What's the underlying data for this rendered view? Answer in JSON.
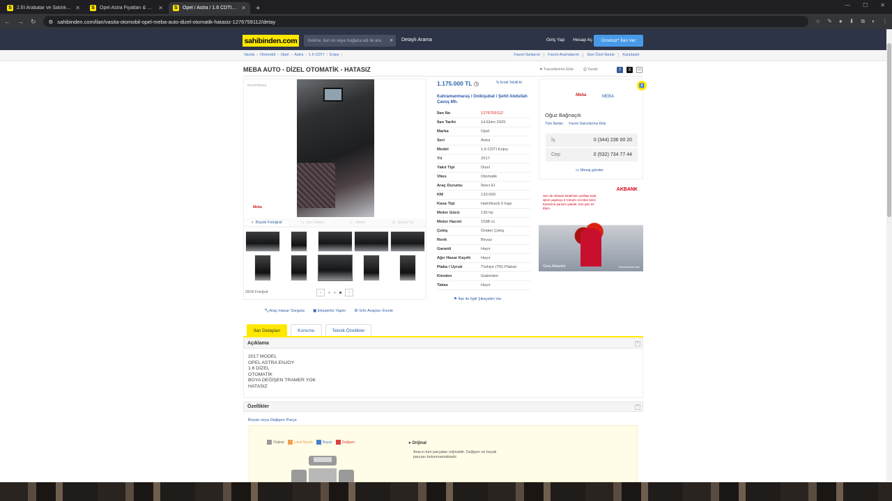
{
  "browser": {
    "tabs": [
      {
        "title": "2.El Arabalar ve Satılık Sıfır Kır...",
        "active": false
      },
      {
        "title": "Opel Astra Fiyatları & Modelle...",
        "active": false
      },
      {
        "title": "Opel / Astra / 1.6 CDTI / Enjoy",
        "active": true
      }
    ],
    "url": "sahibinden.com/ilan/vasita-otomobil-opel-meba-auto-dizel-otomatik-hatasiz-1276759112/detay"
  },
  "header": {
    "logo": "sahibinden.com",
    "search_placeholder": "Kelime, ilan no veya mağaza adı ile ara",
    "detailed_search": "Detaylı Arama",
    "login": "Giriş Yap",
    "register": "Hesap Aç",
    "post_ad": "Ücretsiz* İlan Ver"
  },
  "breadcrumb": [
    "Vasıta",
    "Otomobil",
    "Opel",
    "Astra",
    "1.6 CDTI",
    "Enjoy"
  ],
  "sub_links": [
    "Favori İlanlarım",
    "Favori Aramalarım",
    "Size Özel İlanlar",
    "Karşılaştır"
  ],
  "listing": {
    "title": "MEBA AUTO - DİZEL OTOMATİK - HATASIZ",
    "fav_label": "Favorilerime Ekle",
    "print_label": "Yazdır",
    "ad_number_small": "#1276759112",
    "photo_watermark": "Meba",
    "gallery_tabs": [
      "Büyük Fotoğraf",
      "Ses Video",
      "Video",
      "Sanal Tur"
    ],
    "photo_count": "28/30 Fotoğraf",
    "price": "1.175.000 TL",
    "credit_label": "Kredi Teklifi Al",
    "location": "Kahramanmaraş / Onikişubat / Şehit Abdullah Çavuş Mh.",
    "attributes": [
      {
        "k": "İlan No",
        "v": "1276759112"
      },
      {
        "k": "İlan Tarihi",
        "v": "14 Ekim 2025"
      },
      {
        "k": "Marka",
        "v": "Opel"
      },
      {
        "k": "Seri",
        "v": "Astra"
      },
      {
        "k": "Model",
        "v": "1.6 CDTI Enjoy"
      },
      {
        "k": "Yıl",
        "v": "2017"
      },
      {
        "k": "Yakıt Tipi",
        "v": "Dizel"
      },
      {
        "k": "Vites",
        "v": "Otomatik"
      },
      {
        "k": "Araç Durumu",
        "v": "İkinci El"
      },
      {
        "k": "KM",
        "v": "133.000"
      },
      {
        "k": "Kasa Tipi",
        "v": "Hatchback 5 kapı"
      },
      {
        "k": "Motor Gücü",
        "v": "136 hp"
      },
      {
        "k": "Motor Hacmi",
        "v": "1598 cc"
      },
      {
        "k": "Çekiş",
        "v": "Önden Çekiş"
      },
      {
        "k": "Renk",
        "v": "Beyaz"
      },
      {
        "k": "Garanti",
        "v": "Hayır"
      },
      {
        "k": "Ağır Hasar Kayıtlı",
        "v": "Hayır"
      },
      {
        "k": "Plaka / Uyruk",
        "v": "Türkiye (TR) Plakalı"
      },
      {
        "k": "Kimden",
        "v": "Galeriden"
      },
      {
        "k": "Takas",
        "v": "Hayır"
      }
    ],
    "complaint": "İlan ile İlgili Şikayetim Var",
    "actions": [
      "Araç Hasar Sorgula",
      "Ekspertiz Yaptır",
      "Sıfır Araçları İncele"
    ]
  },
  "seller": {
    "logo_text": "Meba",
    "store": "MEBA",
    "name": "Oğuz Bağrıaçık",
    "links": [
      "Tüm İlanları",
      "Favori Satıcılarıma Ekle"
    ],
    "phones": [
      {
        "label": "İş",
        "number": "0 (344) 236 00 20"
      },
      {
        "label": "Cep",
        "number": "0 (532) 734 77 44"
      }
    ],
    "message": "Mesaj gönder"
  },
  "ad": {
    "brand": "AKBANK",
    "text": "Sen de Akbank Mobil'den çekilişe katıl, işlem yaptıkça 3 Citroën Ami'den birini kazanma şansını yakala. Son gün 31 Ekim",
    "footer": "Genç Akbanklı",
    "footer2": "Güvenmenle sen"
  },
  "tabs": [
    "İlan Detayları",
    "Konumu",
    "Teknik Özellikler"
  ],
  "description": {
    "heading": "Açıklama",
    "text": "2017 MODEL\nOPEL ASTRA ENJOY\n1.6 DİZEL\nOTOMATİK\nBOYA DEĞİŞEN TRAMER YOK\nHATASIZ"
  },
  "features": {
    "heading": "Özellikler",
    "paint_link": "Boyalı veya Değişen Parça",
    "legend": [
      {
        "label": "Orijinal",
        "color": "#999999"
      },
      {
        "label": "Lokal Boyalı",
        "color": "#f0a050"
      },
      {
        "label": "Boyalı",
        "color": "#4a7fc9"
      },
      {
        "label": "Değişen",
        "color": "#d94040"
      }
    ],
    "status_title": "Orijinal",
    "status_text": "Aracın tüm parçaları orijinaldir. Değişen ve boyalı parçası bulunmamaktadır."
  }
}
